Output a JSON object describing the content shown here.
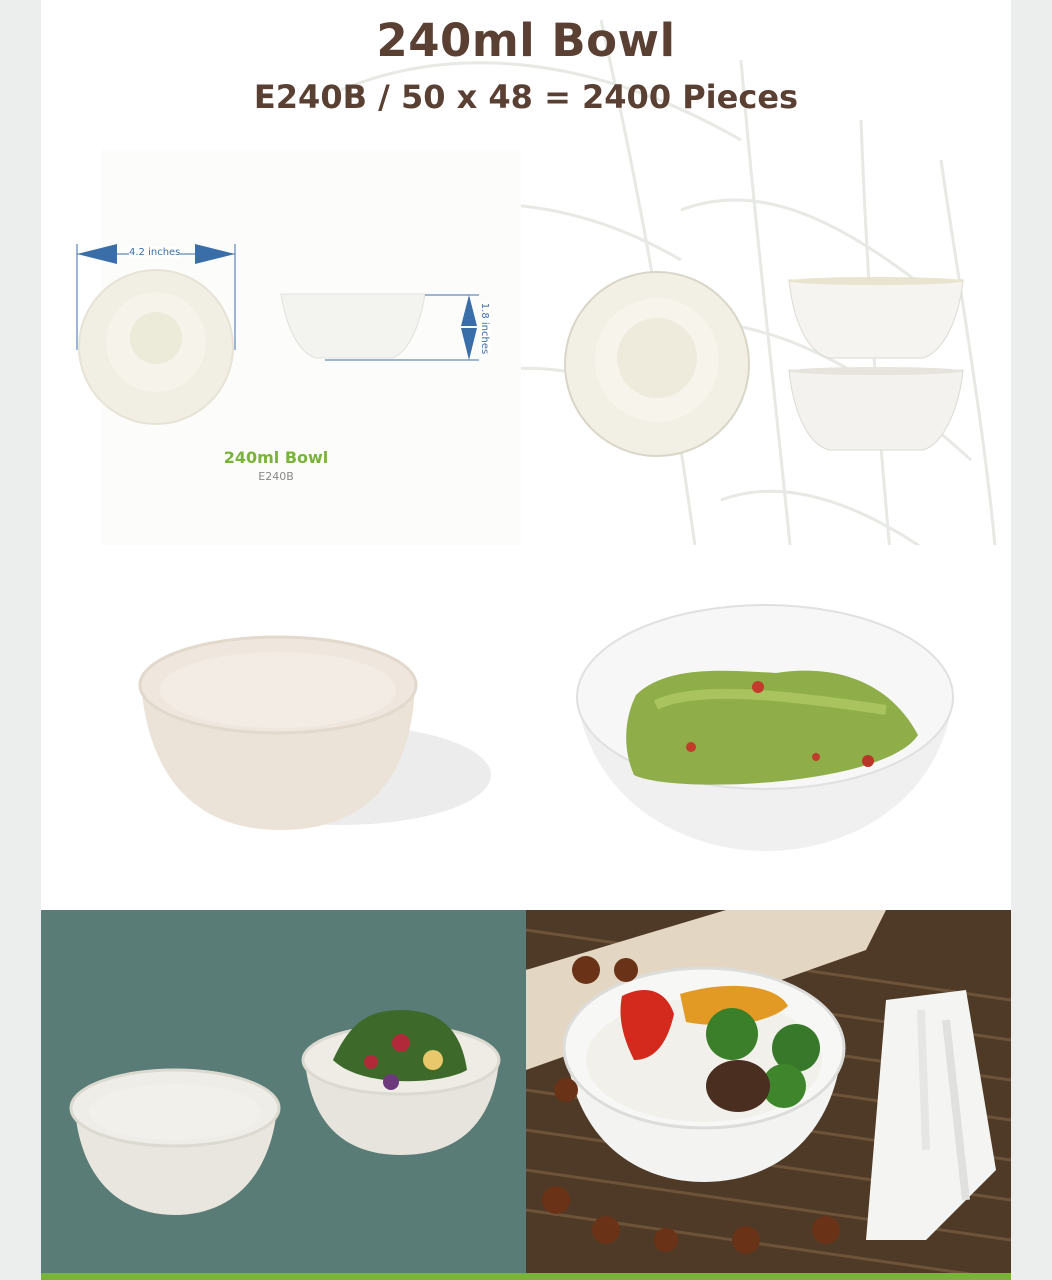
{
  "header": {
    "title": "240ml Bowl",
    "subtitle": "E240B / 50 x 48 = 2400 Pieces"
  },
  "diagram": {
    "width_label": "4.2 inches",
    "height_label": "1.8 inches",
    "product_name": "240ml Bowl",
    "product_code": "E240B"
  },
  "colors": {
    "title": "#5a3f33",
    "accent_green": "#7ab33a",
    "dimension_blue": "#3a6ea8",
    "photo_bg_teal": "#587a74"
  }
}
